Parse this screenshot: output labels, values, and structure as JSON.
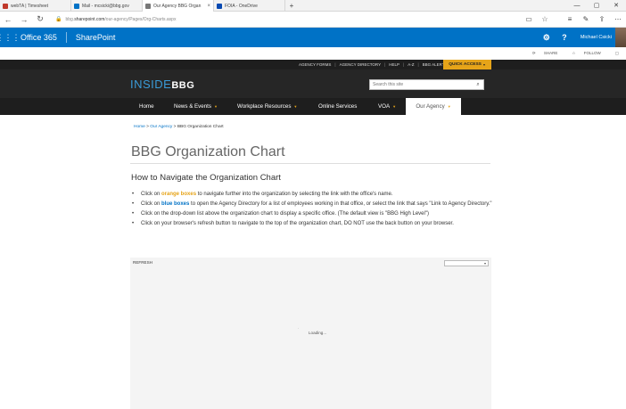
{
  "browser": {
    "tabs": [
      {
        "label": "webTA | Timesheet",
        "favicon_color": "#c0392b",
        "active": false
      },
      {
        "label": "Mail - mcsicki@bbg.gov",
        "favicon_color": "#0072c6",
        "active": false
      },
      {
        "label": "Our Agency BBG Organ",
        "favicon_color": "#777777",
        "active": true
      },
      {
        "label": "FOIA - OneDrive",
        "favicon_color": "#094ab2",
        "active": false
      }
    ],
    "tab_close_glyph": "×",
    "new_tab_glyph": "+",
    "window_controls": [
      "—",
      "▢",
      "✕"
    ],
    "url_prefix": "bbg.",
    "url_domain": "sharepoint.com",
    "url_path": "/our-agency/Pages/Org-Charts.aspx",
    "toolbar_icons": [
      "reading-view-icon",
      "favorite-star-icon",
      "hub-icon",
      "web-note-icon",
      "share-icon",
      "more-icon"
    ]
  },
  "suite": {
    "brand": "Office 365",
    "app": "SharePoint",
    "user": "Michael Csicki",
    "color": "#0072c6"
  },
  "ribbon": {
    "share": "SHARE",
    "follow": "FOLLOW"
  },
  "utility": {
    "links": [
      "AGENCY FORMS",
      "AGENCY DIRECTORY",
      "HELP",
      "A-Z",
      "BBG ALERTS"
    ],
    "quick_access": "QUICK ACCESS",
    "accent": "#e6a419"
  },
  "header": {
    "logo_text": "INSIDE",
    "logo_mark": "BBG",
    "search_placeholder": "Search this site"
  },
  "nav": {
    "items": [
      {
        "label": "Home",
        "has_arrow": false
      },
      {
        "label": "News & Events",
        "has_arrow": true
      },
      {
        "label": "Workplace Resources",
        "has_arrow": true
      },
      {
        "label": "Online Services",
        "has_arrow": false
      },
      {
        "label": "VOA",
        "has_arrow": true
      },
      {
        "label": "Our Agency",
        "has_arrow": true,
        "active": true
      }
    ],
    "arrow_glyph": "▼"
  },
  "content": {
    "breadcrumb": {
      "home": "Home",
      "sep1": " > ",
      "our_agency": "Our Agency",
      "sep2": " > ",
      "current": "BBG Organization Chart"
    },
    "title": "BBG Organization Chart",
    "subtitle": "How to Navigate the Organization Chart",
    "bullets": {
      "b1_pre": "Click on ",
      "b1_em": "orange boxes",
      "b1_post": " to navigate further into the organization by selecting the link with the office's name.",
      "b2_pre": "Click on ",
      "b2_em": "blue boxes",
      "b2_post": " to open the Agency Directory for a list of employees working in that office, or select the link that says \"Link to Agency Directory.\"",
      "b3": "Click on the drop-down list above the organization chart to display a specific office. (The default view is \"BBG High Level\")",
      "b4": "Click on your browser's refresh button to navigate to the top of the organization chart, DO NOT use the back button on your browser."
    },
    "chart": {
      "refresh": "REFRESH",
      "select_value": "",
      "loading": "Loading..."
    }
  }
}
